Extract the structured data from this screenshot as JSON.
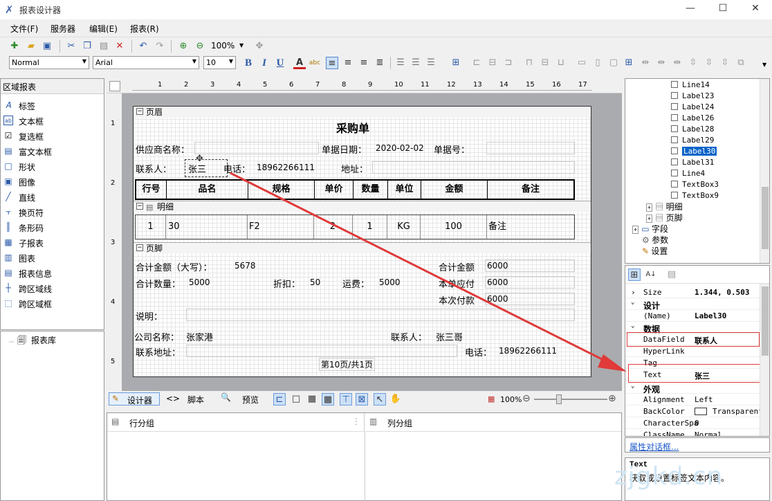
{
  "window": {
    "title": "报表设计器"
  },
  "menu": [
    "文件(F)",
    "服务器",
    "编辑(E)",
    "报表(R)"
  ],
  "toolbar": {
    "zoom": "100%",
    "style": "Normal",
    "font": "Arial",
    "size": "10"
  },
  "left": {
    "header": "区域报表",
    "items": [
      "标签",
      "文本框",
      "复选框",
      "富文本框",
      "形状",
      "图像",
      "直线",
      "换页符",
      "条形码",
      "子报表",
      "图表",
      "报表信息",
      "跨区域线",
      "跨区域框"
    ],
    "library": "报表库"
  },
  "report": {
    "band_header": "页眉",
    "band_detail": "明细",
    "band_footer": "页脚",
    "title": "采购单",
    "supplier_label": "供应商名称：",
    "date_label": "单据日期：",
    "date_value": "2020-02-02",
    "docno_label": "单据号：",
    "contact_label": "联系人：",
    "contact_value": "张三",
    "phone_label": "电话：",
    "phone_value": "18962266111",
    "addr_label": "地址：",
    "columns": [
      "行号",
      "品名",
      "规格",
      "单价",
      "数量",
      "单位",
      "金额",
      "备注"
    ],
    "row": [
      "1",
      "30",
      "F2",
      "2",
      "1",
      "KG",
      "100",
      "备注"
    ],
    "footer": {
      "total_amount_cn_label": "合计金额（大写）：",
      "total_amount_cn_value": "5678",
      "total_amount_label": "合计金额",
      "total_amount_value": "6000",
      "total_qty_label": "合计数量：",
      "total_qty_value": "5000",
      "discount_label": "折扣：",
      "discount_value": "50",
      "freight_label": "运费：",
      "freight_value": "5000",
      "payable_label": "本单应付",
      "payable_value": "6000",
      "paid_label": "本次付款",
      "paid_value": "6000",
      "note_label": "说明：",
      "company_label": "公司名称：",
      "company_value": "张家港",
      "fcontact_label": "联系人：",
      "fcontact_value": "张三哥",
      "faddr_label": "联系地址：",
      "fphone_label": "电话：",
      "fphone_value": "18962266111",
      "pageinfo": "第10页/共1页"
    }
  },
  "ruler_marks": [
    "1",
    "2",
    "3",
    "4",
    "5",
    "6",
    "7",
    "8",
    "9",
    "10",
    "11",
    "12",
    "13",
    "14",
    "15",
    "16",
    "17"
  ],
  "vruler_marks": [
    "1",
    "2",
    "3",
    "4",
    "5"
  ],
  "design_tabs": {
    "designer": "设计器",
    "script": "脚本",
    "preview": "预览",
    "zoom": "100%"
  },
  "groups": {
    "row": "行分组",
    "col": "列分组"
  },
  "tree": {
    "items": [
      "Line14",
      "Label23",
      "Label24",
      "Label26",
      "Label28",
      "Label29",
      "Label30",
      "Label31",
      "Line4",
      "TextBox3",
      "TextBox9"
    ],
    "selected": "Label30",
    "nodes": [
      "明细",
      "页脚",
      "字段",
      "参数",
      "设置"
    ]
  },
  "props": {
    "size_k": "Size",
    "size_v": "1.344, 0.503",
    "cat_design": "设计",
    "name_k": "(Name)",
    "name_v": "Label30",
    "cat_data": "数据",
    "datafield_k": "DataField",
    "datafield_v": "联系人",
    "hyperlink_k": "HyperLink",
    "tag_k": "Tag",
    "text_k": "Text",
    "text_v": "张三",
    "cat_look": "外观",
    "align_k": "Alignment",
    "align_v": "Left",
    "back_k": "BackColor",
    "back_v": "Transparent",
    "charsp_k": "CharacterSpa",
    "charsp_v": "0",
    "class_k": "ClassName",
    "class_v": "Normal",
    "dialog_link": "属性对话框...",
    "desc_title": "Text",
    "desc_text": "获取或设置标签文本内容。"
  },
  "watermark": "zjgkd.cn",
  "colors": {
    "arrow": "#e03a3a",
    "selection": "#0a64c8"
  }
}
